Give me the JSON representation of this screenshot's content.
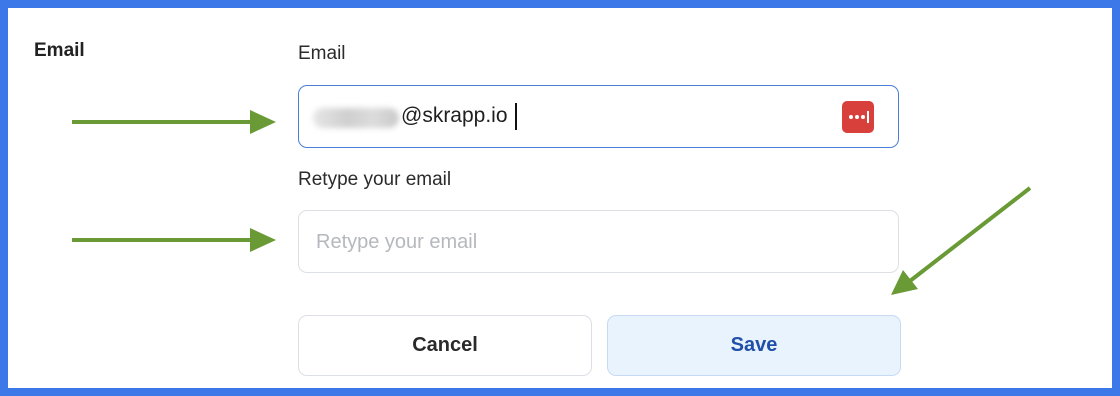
{
  "section": {
    "title": "Email"
  },
  "email_field": {
    "label": "Email",
    "value_visible": "@skrapp.io",
    "password_manager_icon": "password-manager-icon"
  },
  "retype_field": {
    "label": "Retype your email",
    "placeholder": "Retype your email"
  },
  "buttons": {
    "cancel_label": "Cancel",
    "save_label": "Save"
  },
  "colors": {
    "frame": "#3d78e8",
    "arrow": "#6a9a36",
    "focus_border": "#4a7fd9",
    "save_bg": "#e9f3fd",
    "save_text": "#1f4fa8",
    "pw_icon": "#d8403b"
  }
}
